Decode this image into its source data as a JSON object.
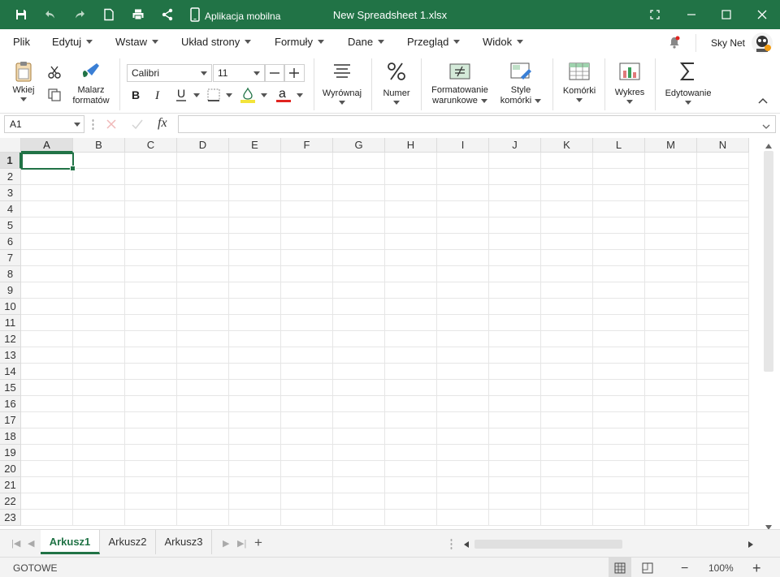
{
  "titlebar": {
    "mobile_label": "Aplikacja mobilna",
    "title": "New Spreadsheet 1.xlsx",
    "bg_color": "#217346"
  },
  "menu": {
    "items": [
      {
        "label": "Plik",
        "dropdown": false
      },
      {
        "label": "Edytuj",
        "dropdown": true
      },
      {
        "label": "Wstaw",
        "dropdown": true
      },
      {
        "label": "Układ strony",
        "dropdown": true
      },
      {
        "label": "Formuły",
        "dropdown": true
      },
      {
        "label": "Dane",
        "dropdown": true
      },
      {
        "label": "Przegląd",
        "dropdown": true
      },
      {
        "label": "Widok",
        "dropdown": true
      }
    ],
    "user_name": "Sky Net"
  },
  "ribbon": {
    "paste_label": "Wkiej",
    "painter_label_1": "Malarz",
    "painter_label_2": "formatów",
    "font_name": "Calibri",
    "font_size": "11",
    "align_label": "Wyrównaj",
    "number_label": "Numer",
    "cond_format_label_1": "Formatowanie",
    "cond_format_label_2": "warunkowe",
    "cell_styles_label_1": "Style",
    "cell_styles_label_2": "komórki",
    "cells_label": "Komórki",
    "chart_label": "Wykres",
    "editing_label": "Edytowanie",
    "highlight_color": "#f3e43a",
    "font_color": "#e0241f"
  },
  "formula_bar": {
    "name_box": "A1",
    "fx_symbol": "fx",
    "formula": ""
  },
  "grid": {
    "columns": [
      "A",
      "B",
      "C",
      "D",
      "E",
      "F",
      "G",
      "H",
      "I",
      "J",
      "K",
      "L",
      "M",
      "N"
    ],
    "rows": [
      "1",
      "2",
      "3",
      "4",
      "5",
      "6",
      "7",
      "8",
      "9",
      "10",
      "11",
      "12",
      "13",
      "14",
      "15",
      "16",
      "17",
      "18",
      "19",
      "20",
      "21",
      "22",
      "23"
    ],
    "selected_cell": "A1",
    "accent": "#217346"
  },
  "sheets": {
    "tabs": [
      "Arkusz1",
      "Arkusz2",
      "Arkusz3"
    ],
    "active": "Arkusz1"
  },
  "status": {
    "text": "GOTOWE",
    "zoom": "100%"
  }
}
